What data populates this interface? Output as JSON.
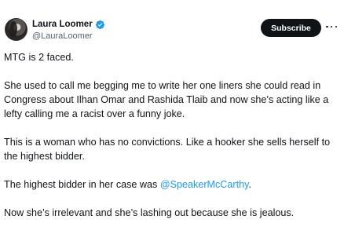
{
  "author": {
    "display_name": "Laura Loomer",
    "handle": "@LauraLoomer",
    "verified": true,
    "verified_color": "#1d9bf0"
  },
  "actions": {
    "subscribe_label": "Subscribe",
    "more_icon": "more-horizontal-icon"
  },
  "tweet": {
    "p1": "MTG is 2 faced.",
    "p2": "She used to call me begging me to write her one liners she could read in Congress about Ilhan Omar and Rashida Tlaib and now she’s acting like a lefty calling me a racist over a funny joke.",
    "p3": "This is a woman who has no convictions. Like a hooker she sells herself to the highest bidder.",
    "p4_before": "The highest bidder in her case was ",
    "p4_mention": "@SpeakerMcCarthy",
    "p4_after": ".",
    "p5": "Now she’s irrelevant and she’s lashing out because she is jealous."
  },
  "colors": {
    "text": "#0f1419",
    "secondary": "#536471",
    "link": "#1d9bf0"
  }
}
